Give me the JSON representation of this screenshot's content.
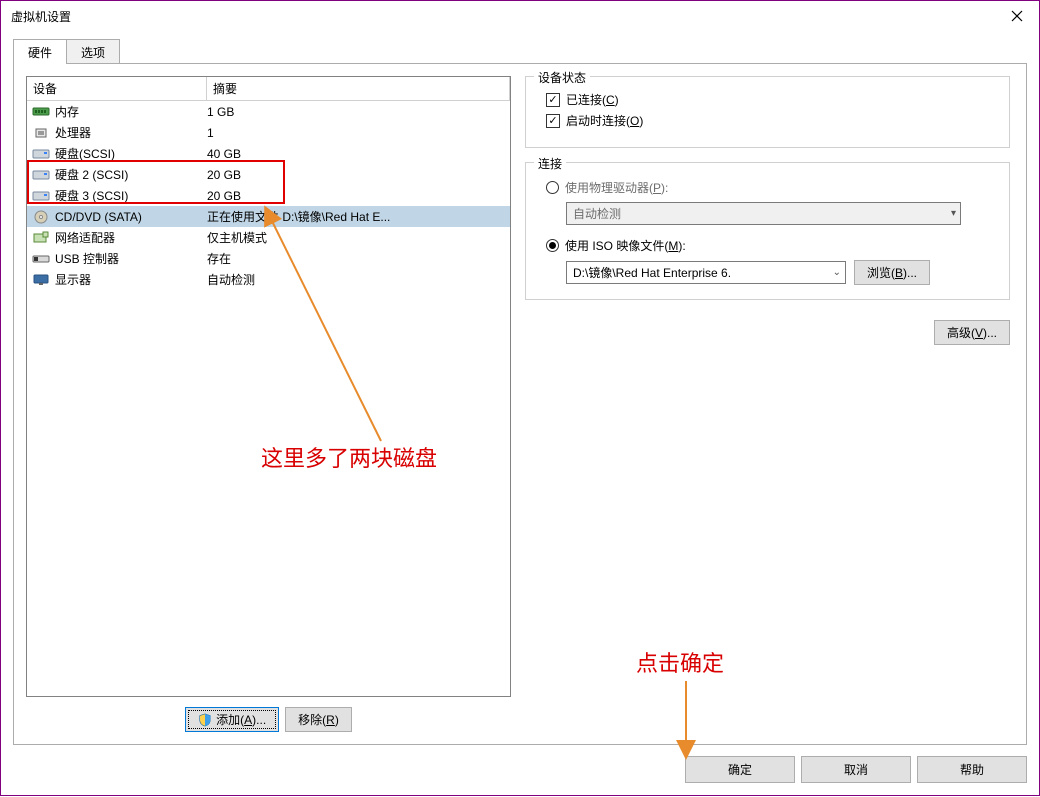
{
  "window": {
    "title": "虚拟机设置"
  },
  "tabs": {
    "hardware": "硬件",
    "options": "选项"
  },
  "device_list": {
    "header_device": "设备",
    "header_summary": "摘要",
    "rows": [
      {
        "icon": "memory",
        "name": "内存",
        "summary": "1 GB"
      },
      {
        "icon": "cpu",
        "name": "处理器",
        "summary": "1"
      },
      {
        "icon": "disk",
        "name": "硬盘(SCSI)",
        "summary": "40 GB"
      },
      {
        "icon": "disk",
        "name": "硬盘 2 (SCSI)",
        "summary": "20 GB"
      },
      {
        "icon": "disk",
        "name": "硬盘 3 (SCSI)",
        "summary": "20 GB"
      },
      {
        "icon": "cd",
        "name": "CD/DVD (SATA)",
        "summary": "正在使用文件 D:\\镜像\\Red Hat E..."
      },
      {
        "icon": "nic",
        "name": "网络适配器",
        "summary": "仅主机模式"
      },
      {
        "icon": "usb",
        "name": "USB 控制器",
        "summary": "存在"
      },
      {
        "icon": "display",
        "name": "显示器",
        "summary": "自动检测"
      }
    ]
  },
  "buttons": {
    "add_pre": "添加(",
    "add_key": "A",
    "add_post": ")...",
    "remove_pre": "移除(",
    "remove_key": "R",
    "remove_post": ")",
    "browse_pre": "浏览(",
    "browse_key": "B",
    "browse_post": ")...",
    "advanced_pre": "高级(",
    "advanced_key": "V",
    "advanced_post": ")...",
    "ok": "确定",
    "cancel": "取消",
    "help": "帮助"
  },
  "status_group": {
    "title": "设备状态",
    "connected_pre": "已连接(",
    "connected_key": "C",
    "connected_post": ")",
    "poweron_pre": "启动时连接(",
    "poweron_key": "O",
    "poweron_post": ")"
  },
  "connection_group": {
    "title": "连接",
    "physical_pre": "使用物理驱动器(",
    "physical_key": "P",
    "physical_post": "):",
    "auto_detect": "自动检测",
    "iso_pre": "使用 ISO 映像文件(",
    "iso_key": "M",
    "iso_post": "):",
    "iso_value": "D:\\镜像\\Red Hat Enterprise 6."
  },
  "annotations": {
    "line1": "这里多了两块磁盘",
    "line2": "点击确定"
  }
}
